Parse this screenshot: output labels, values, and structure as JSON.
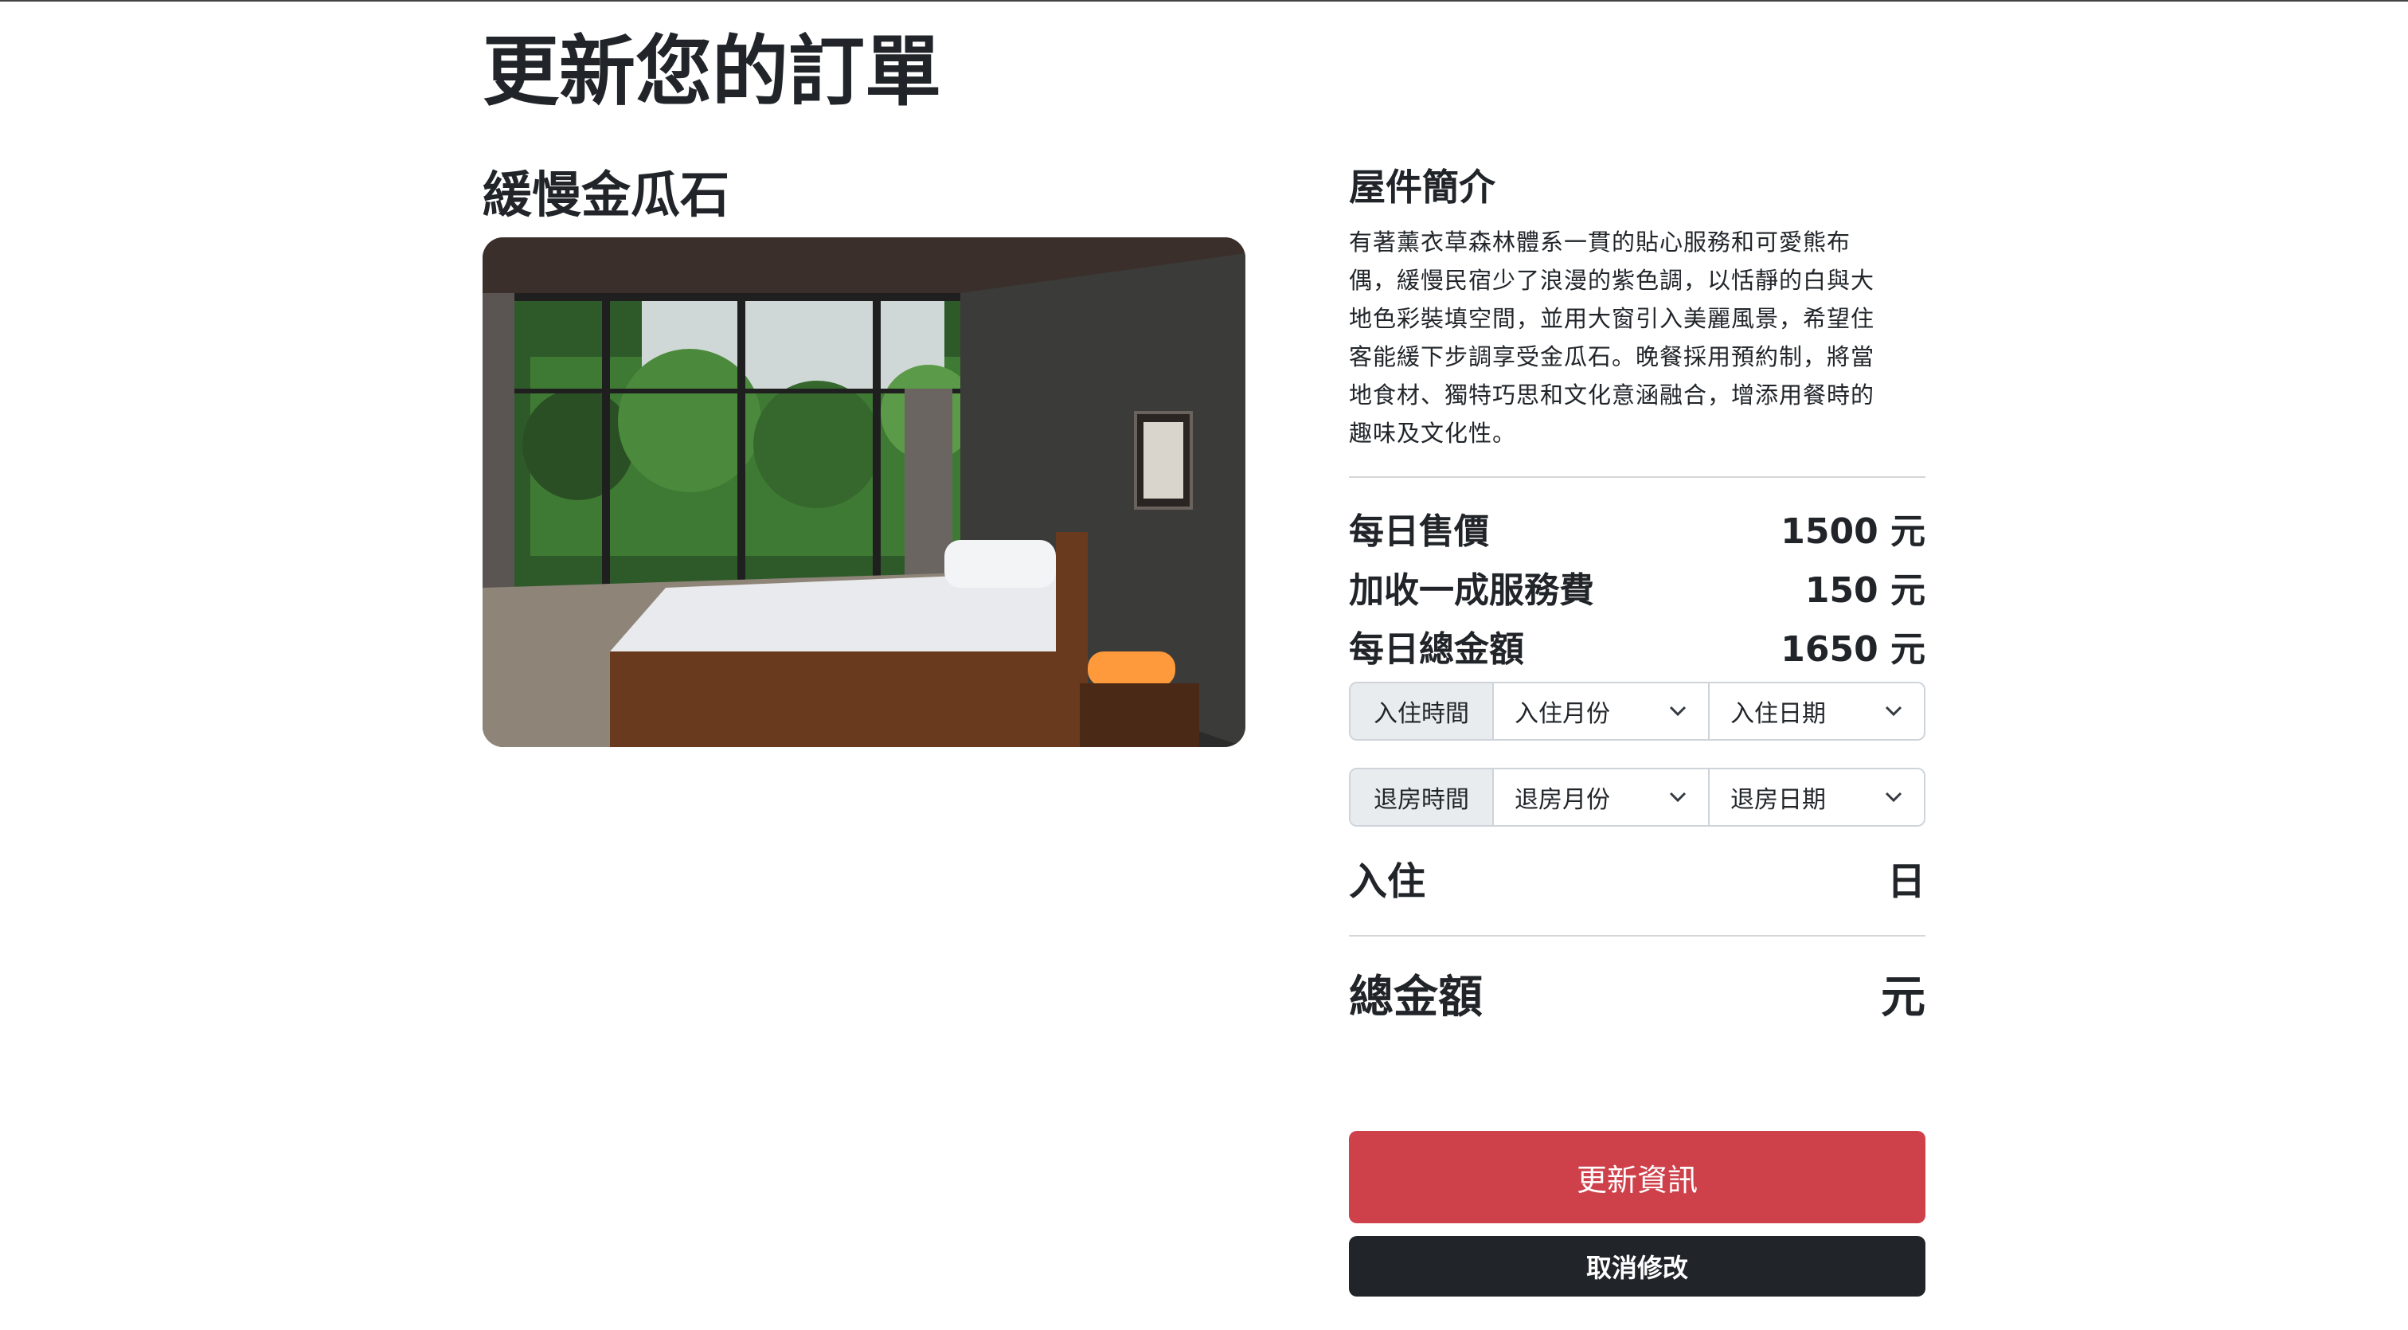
{
  "page": {
    "title": "更新您的訂單"
  },
  "room": {
    "name": "緩慢金瓜石",
    "photo_icon": "room-photo"
  },
  "intro": {
    "title": "屋件簡介",
    "lines": [
      "有著薰衣草森林體系一貫的貼心服務和可愛熊布",
      "偶，緩慢民宿少了浪漫的紫色調，以恬靜的白與大",
      "地色彩裝填空間，並用大窗引入美麗風景，希望住",
      "客能緩下步調享受金瓜石。晚餐採用預約制，將當",
      "地食材、獨特巧思和文化意涵融合，增添用餐時的",
      "趣味及文化性。"
    ]
  },
  "pricing": {
    "daily_price_label": "每日售價",
    "daily_price_value": "1500 元",
    "service_fee_label": "加收一成服務費",
    "service_fee_value": "150 元",
    "daily_total_label": "每日總金額",
    "daily_total_value": "1650 元"
  },
  "checkin": {
    "label": "入住時間",
    "month_selected": "入住月份",
    "day_selected": "入住日期"
  },
  "checkout": {
    "label": "退房時間",
    "month_selected": "退房月份",
    "day_selected": "退房日期"
  },
  "stay": {
    "label": "入住",
    "unit": "日"
  },
  "total": {
    "label": "總金額",
    "unit": "元"
  },
  "buttons": {
    "update_label": "更新資訊",
    "cancel_label": "取消修改"
  },
  "colors": {
    "update_button": "#cf414a",
    "cancel_button": "#212529",
    "addon_background": "#e9ecef"
  }
}
